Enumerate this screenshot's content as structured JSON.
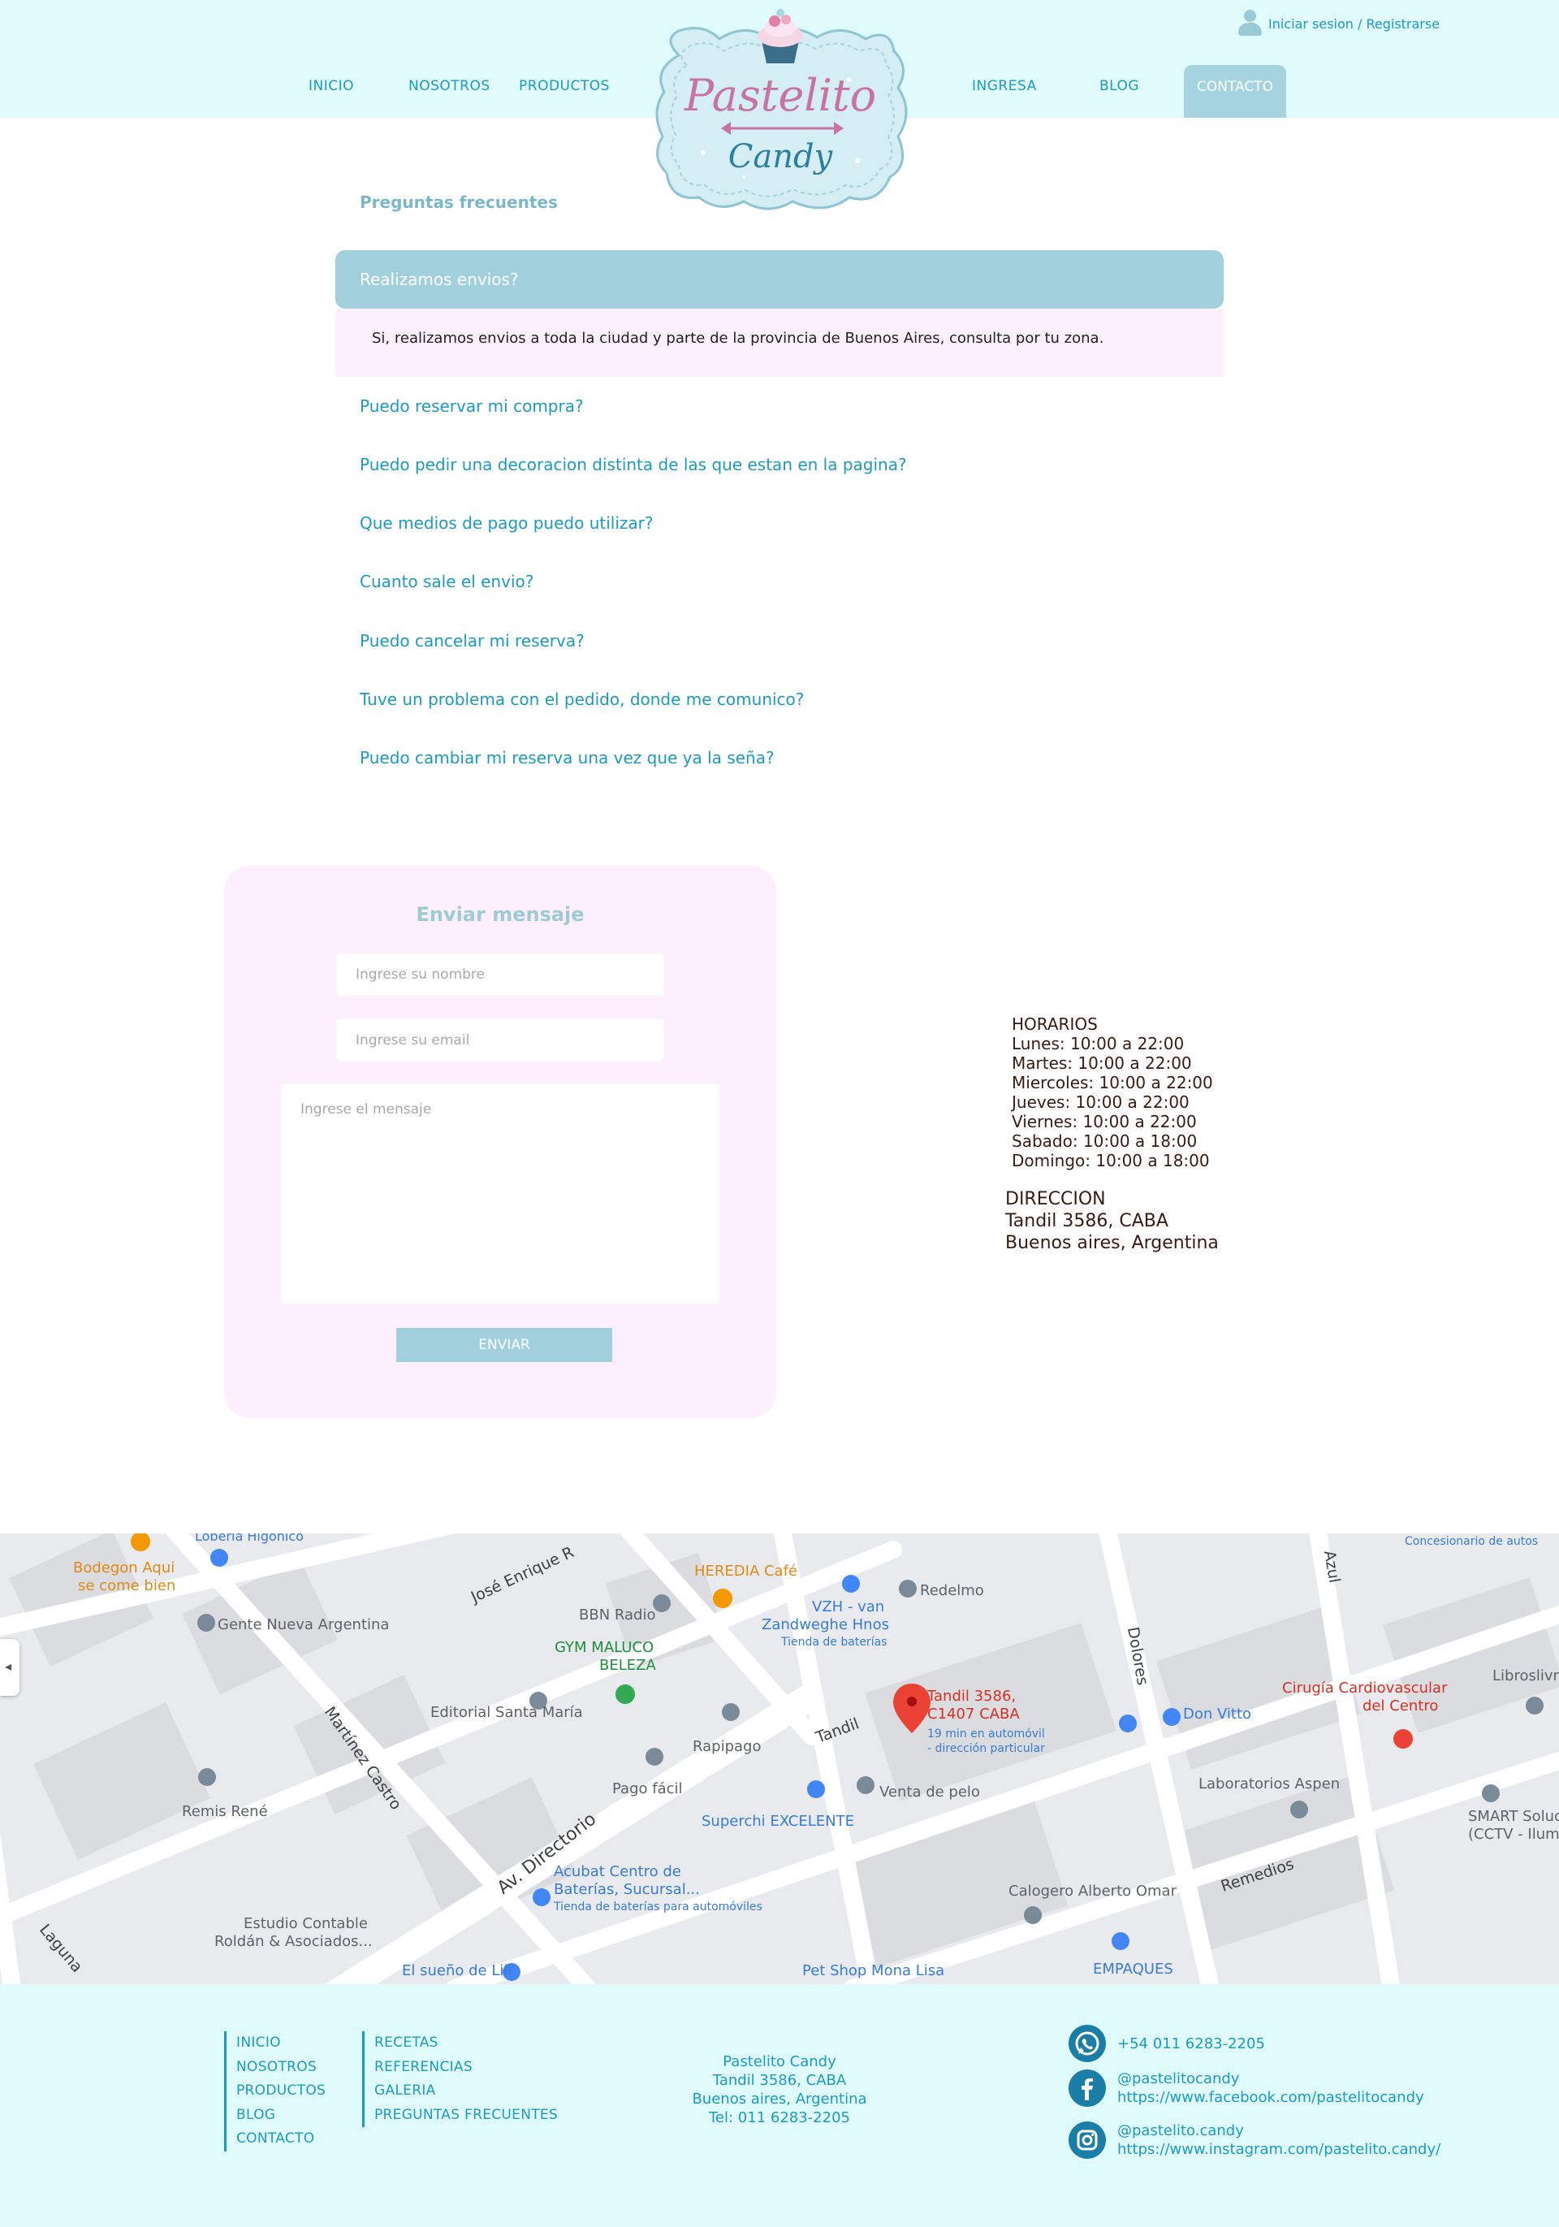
{
  "header": {
    "nav": [
      "INICIO",
      "NOSOTROS",
      "PRODUCTOS",
      "INGRESA",
      "BLOG",
      "CONTACTO"
    ],
    "user_link": "Iniciar sesion / Registrarse",
    "logo": {
      "line1": "Pastelito",
      "line2": "Candy"
    }
  },
  "faq": {
    "title": "Preguntas frecuentes",
    "open_question": "Realizamos envios?",
    "open_answer": "Si, realizamos envios a toda la ciudad y parte de la provincia de Buenos Aires, consulta por tu zona.",
    "questions": [
      "Puedo reservar mi compra?",
      "Puedo pedir una decoracion distinta de las que estan en la pagina?",
      "Que medios de pago puedo utilizar?",
      "Cuanto sale el envio?",
      "Puedo cancelar mi reserva?",
      "Tuve un problema con el pedido, donde me comunico?",
      "Puedo cambiar mi reserva una vez que ya la seña?"
    ]
  },
  "form": {
    "title": "Enviar mensaje",
    "name_placeholder": "Ingrese su nombre",
    "email_placeholder": "Ingrese su email",
    "message_placeholder": "Ingrese el mensaje",
    "submit_label": "ENVIAR"
  },
  "hours": {
    "title": "HORARIOS",
    "lines": [
      "Lunes: 10:00 a 22:00",
      "Martes: 10:00 a 22:00",
      "Miercoles: 10:00 a 22:00",
      "Jueves: 10:00 a 22:00",
      "Viernes: 10:00 a 22:00",
      "Sabado: 10:00 a 18:00",
      "Domingo: 10:00 a 18:00"
    ]
  },
  "address": {
    "title": "DIRECCION",
    "line1": "Tandil 3586, CABA",
    "line2": "Buenos aires, Argentina"
  },
  "map": {
    "pin_title_1": "Tandil 3586,",
    "pin_title_2": "C1407 CABA",
    "pin_sub_1": "19 min en automóvil",
    "pin_sub_2": "- dirección particular",
    "places": [
      "Bodegon Aqui",
      "se come bien",
      "Loberia Higonico",
      "José Enrique R",
      "Gente Nueva Argentina",
      "BBN Radio",
      "HEREDIA Café",
      "VZH - van",
      "Zandweghe Hnos",
      "Tienda de baterías",
      "Redelmo",
      "GYM MALUCO",
      "BELEZA",
      "Editorial Santa María",
      "Rapipago",
      "Pago fácil",
      "Martínez Castro",
      "Remis René",
      "Av. Directorio",
      "Superchi EXCELENTE",
      "Venta de pelo",
      "Tandil",
      "Dolores",
      "Don Vitto",
      "Cirugía Cardiovascular",
      "del Centro",
      "Laboratorios Aspen",
      "Libroslivre",
      "SMART Soluci",
      "(CCTV - Ilumi",
      "Acubat Centro de",
      "Baterías, Sucursal...",
      "Tienda de baterías para automóviles",
      "Estudio Contable",
      "Roldán & Asociados...",
      "Calogero Alberto Omar",
      "Remedios",
      "EMPAQUES",
      "Pet Shop Mona Lisa",
      "El sueño de Lili",
      "Laguna",
      "Azul",
      "Concesionario de autos"
    ]
  },
  "footer": {
    "col1": [
      "INICIO",
      "NOSOTROS",
      "PRODUCTOS",
      "BLOG",
      "CONTACTO"
    ],
    "col2": [
      "RECETAS",
      "REFERENCIAS",
      "GALERIA",
      "PREGUNTAS FRECUENTES"
    ],
    "contact": [
      "Pastelito Candy",
      "Tandil 3586, CABA",
      "Buenos aires, Argentina",
      "Tel: 011 6283-2205"
    ],
    "whatsapp": "+54 011 6283-2205",
    "facebook_handle": "@pastelitocandy",
    "facebook_url": "https://www.facebook.com/pastelitocandy",
    "instagram_handle": "@pastelito.candy",
    "instagram_url": "https://www.instagram.com/pastelito.candy/"
  },
  "colors": {
    "header_bg": "#e0fbfc",
    "accent": "#1b9bc1",
    "faq_active": "#a1d0dc",
    "pink_bg": "#fdeffd"
  }
}
